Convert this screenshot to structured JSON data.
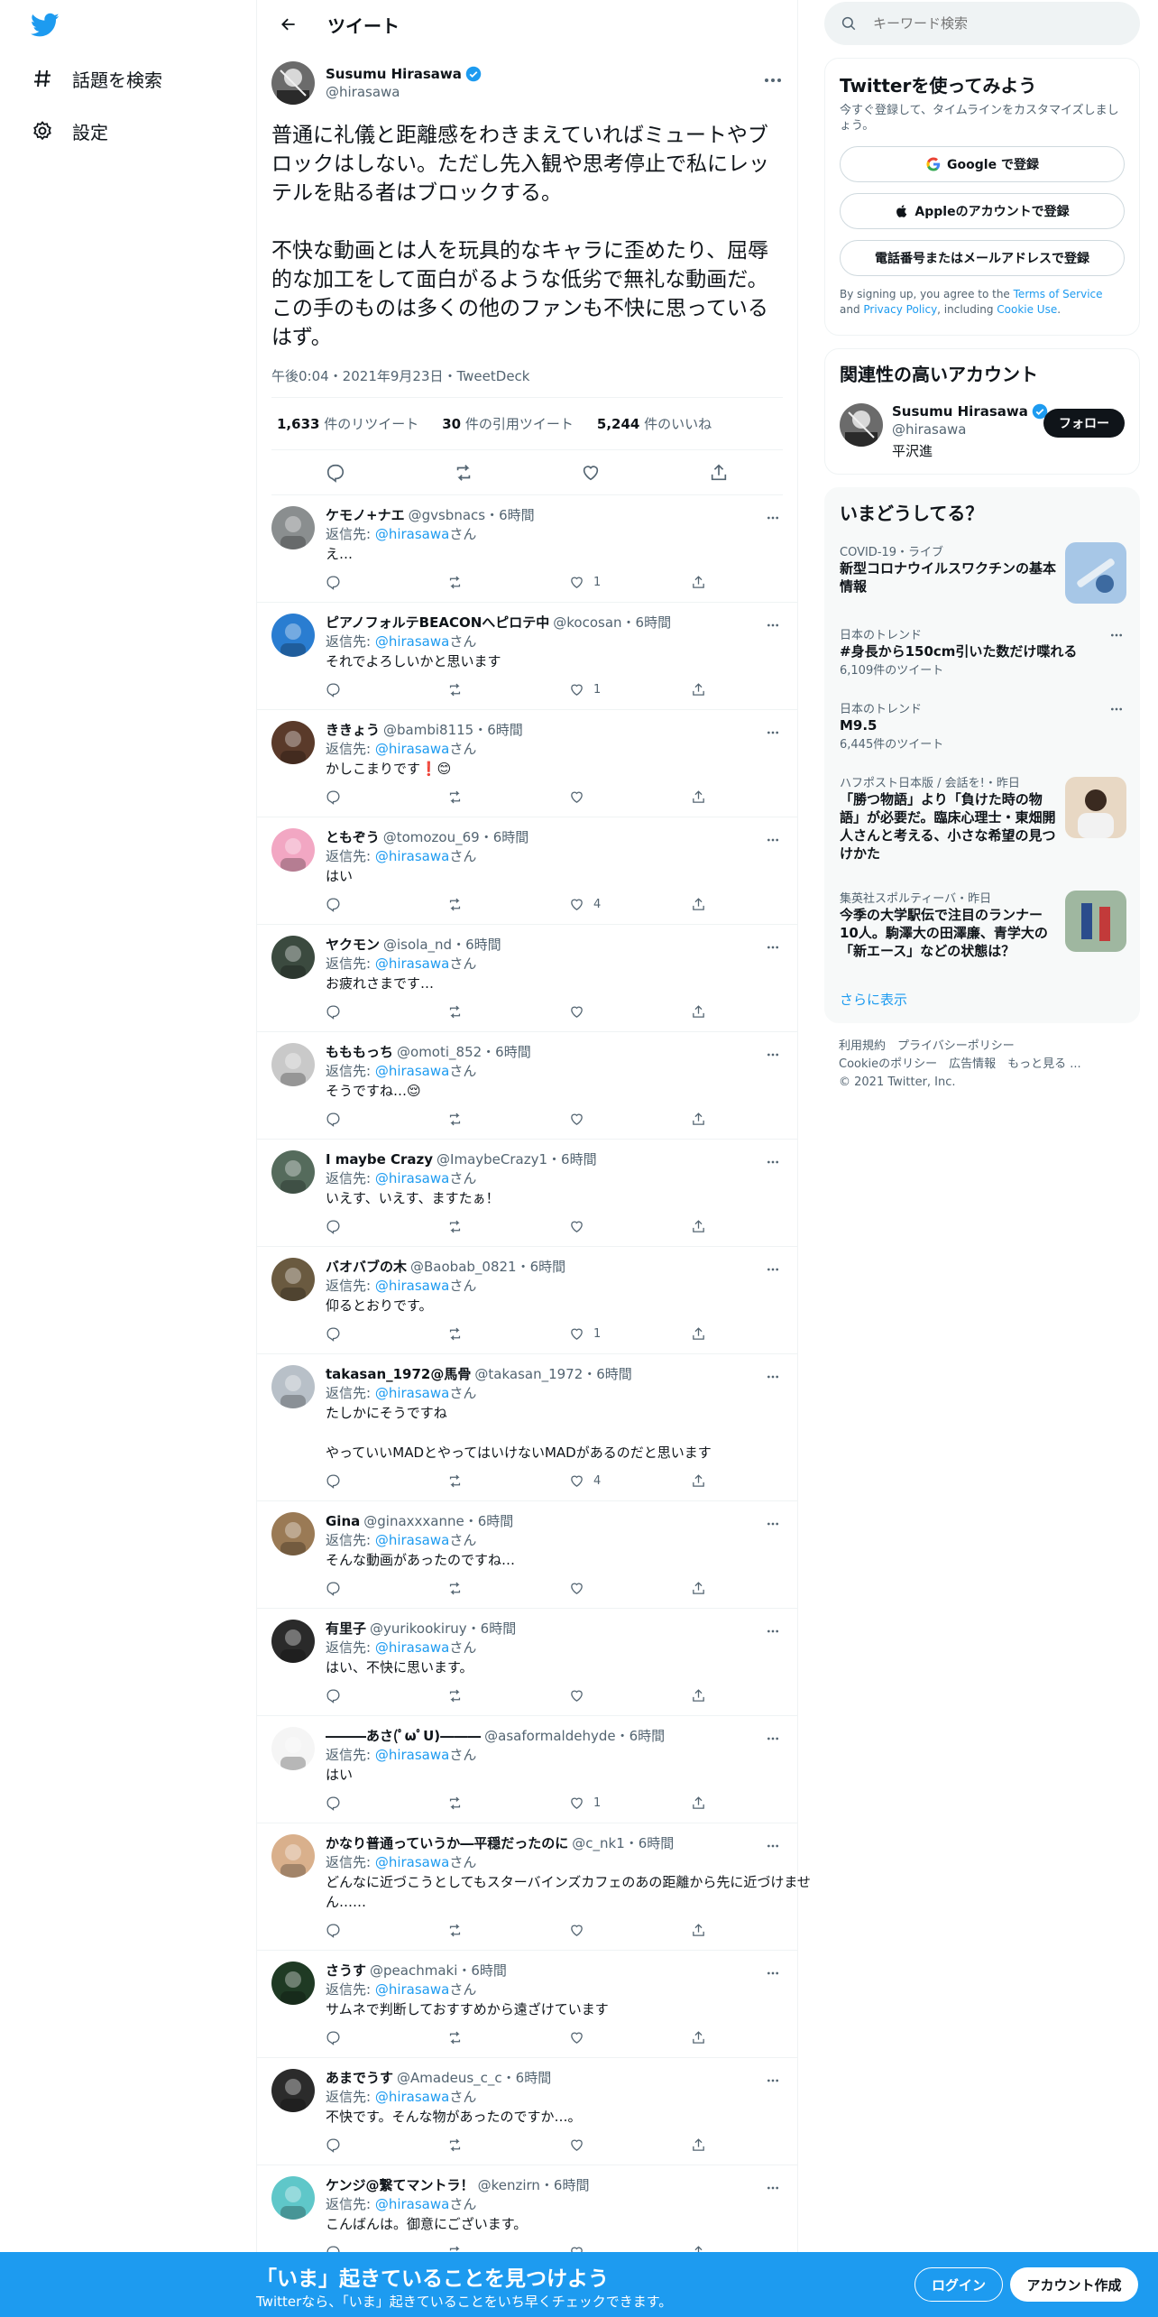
{
  "nav": {
    "explore_label": "話題を検索",
    "settings_label": "設定"
  },
  "header": {
    "title": "ツイート"
  },
  "tweet": {
    "name": "Susumu Hirasawa",
    "handle": "@hirasawa",
    "text": "普通に礼儀と距離感をわきまえていればミュートやブロックはしない。ただし先入観や思考停止で私にレッテルを貼る者はブロックする。\n\n不快な動画とは人を玩具的なキャラに歪めたり、屈辱的な加工をして面白がるような低劣で無礼な動画だ。この手のものは多くの他のファンも不快に思っているはず。",
    "meta": "午後0:04・2021年9月23日・TweetDeck",
    "retweets_count": "1,633",
    "retweets_label": "件のリツイート",
    "quotes_count": "30",
    "quotes_label": "件の引用ツイート",
    "likes_count": "5,244",
    "likes_label": "件のいいね"
  },
  "reply_prefix": "返信先: ",
  "reply_suffix": "さん",
  "reply_target": "@hirasawa",
  "replies": [
    {
      "name": "ケモノ+ナエ",
      "handle": "@gvsbnacs",
      "time": "・6時間",
      "text": "え…",
      "likes": "1",
      "color": "#8a8e8f"
    },
    {
      "name": "ピアノフォルテBEACONへピロテ中",
      "handle": "@kocosan",
      "time": "・6時間",
      "text": "それでよろしいかと思います",
      "likes": "1",
      "color": "#2a7dd1"
    },
    {
      "name": "ききょう",
      "handle": "@bambi8115",
      "time": "・6時間",
      "text": "かしこまりです❗️😊",
      "likes": "",
      "color": "#5a3a2a"
    },
    {
      "name": "ともぞう",
      "handle": "@tomozou_69",
      "time": "・6時間",
      "text": "はい",
      "likes": "4",
      "color": "#f2a7c3"
    },
    {
      "name": "ヤクモン",
      "handle": "@isola_nd",
      "time": "・6時間",
      "text": "お疲れさまです…",
      "likes": "",
      "color": "#3b4a3f"
    },
    {
      "name": "もももっち",
      "handle": "@omoti_852",
      "time": "・6時間",
      "text": "そうですね…😌",
      "likes": "",
      "color": "#c9c9c9"
    },
    {
      "name": "I maybe Crazy",
      "handle": "@ImaybeCrazy1",
      "time": "・6時間",
      "text": "いえす、いえす、ますたぁ！",
      "likes": "",
      "color": "#556b5c"
    },
    {
      "name": "バオバブの木",
      "handle": "@Baobab_0821",
      "time": "・6時間",
      "text": "仰るとおりです。",
      "likes": "1",
      "color": "#6a5a40"
    },
    {
      "name": "takasan_1972@馬骨",
      "handle": "@takasan_1972",
      "time": "・6時間",
      "text": "たしかにそうですね\n\nやっていいMADとやってはいけないMADがあるのだと思います",
      "likes": "4",
      "color": "#b8c0c8"
    },
    {
      "name": "Gina",
      "handle": "@ginaxxxanne",
      "time": "・6時間",
      "text": "そんな動画があったのですね…",
      "likes": "",
      "color": "#9a7a55"
    },
    {
      "name": "有里子",
      "handle": "@yurikookiruy",
      "time": "・6時間",
      "text": "はい、不快に思います。",
      "likes": "",
      "color": "#2a2a2a"
    },
    {
      "name": "―――あさ(ﾟωﾟU)―――",
      "handle": "@asaformaldehyde",
      "time": "・6時間",
      "text": "はい",
      "likes": "1",
      "color": "#f5f5f5"
    },
    {
      "name": "かなり普通っていうか―平穏だったのに",
      "handle": "@c_nk1",
      "time": "・6時間",
      "text": "どんなに近づこうとしてもスターバインズカフェのあの距離から先に近づけません……",
      "likes": "",
      "color": "#d9b08c"
    },
    {
      "name": "さうす",
      "handle": "@peachmaki",
      "time": "・6時間",
      "text": "サムネで判断しておすすめから遠ざけています",
      "likes": "",
      "color": "#1f3a24"
    },
    {
      "name": "あまでうす",
      "handle": "@Amadeus_c_c",
      "time": "・6時間",
      "text": "不快です。そんな物があったのですか…。",
      "likes": "",
      "color": "#2b2b2b"
    },
    {
      "name": "ケンジ@繋てマントラ！",
      "handle": "@kenzirn",
      "time": "・6時間",
      "text": "こんばんは。御意にございます。",
      "likes": "",
      "color": "#5fc7c9"
    }
  ],
  "search": {
    "placeholder": "キーワード検索"
  },
  "signup": {
    "title": "Twitterを使ってみよう",
    "subtitle": "今すぐ登録して、タイムラインをカスタマイズしましょう。",
    "google": "Google で登録",
    "apple": "Appleのアカウントで登録",
    "phone": "電話番号またはメールアドレスで登録",
    "legal_1": "By signing up, you agree to the ",
    "terms": "Terms of Service",
    "legal_2": " and ",
    "privacy": "Privacy Policy",
    "legal_3": ", including ",
    "cookie": "Cookie Use",
    "legal_4": "."
  },
  "related": {
    "title": "関連性の高いアカウント",
    "name": "Susumu Hirasawa",
    "handle": "@hirasawa",
    "bio": "平沢進",
    "follow": "フォロー"
  },
  "trends": {
    "title": "いまどうしてる？",
    "items": [
      {
        "meta": "COVID-19・ライブ",
        "title": "新型コロナウイルスワクチンの基本情報",
        "count": ""
      },
      {
        "meta": "日本のトレンド",
        "title": "#身長から150cm引いた数だけ喋れる",
        "count": "6,109件のツイート"
      },
      {
        "meta": "日本のトレンド",
        "title": "M9.5",
        "count": "6,445件のツイート"
      },
      {
        "meta": "ハフポスト日本版 / 会話を!・昨日",
        "title": "「勝つ物語」より「負けた時の物語」が必要だ。臨床心理士・東畑開人さんと考える、小さな希望の見つけかた",
        "count": ""
      },
      {
        "meta": "集英社スポルティーバ・昨日",
        "title": "今季の大学駅伝で注目のランナー10人。駒澤大の田澤廉、青学大の「新エース」などの状態は？",
        "count": ""
      }
    ],
    "show_more": "さらに表示"
  },
  "footer": {
    "line1": "利用規約　プライバシーポリシー",
    "line2": "Cookieのポリシー　広告情報　もっと見る ...",
    "line3": "© 2021 Twitter, Inc."
  },
  "bottom": {
    "title": "「いま」起きていることを見つけよう",
    "subtitle": "Twitterなら、「いま」起きていることをいち早くチェックできます。",
    "login": "ログイン",
    "signup": "アカウント作成"
  }
}
